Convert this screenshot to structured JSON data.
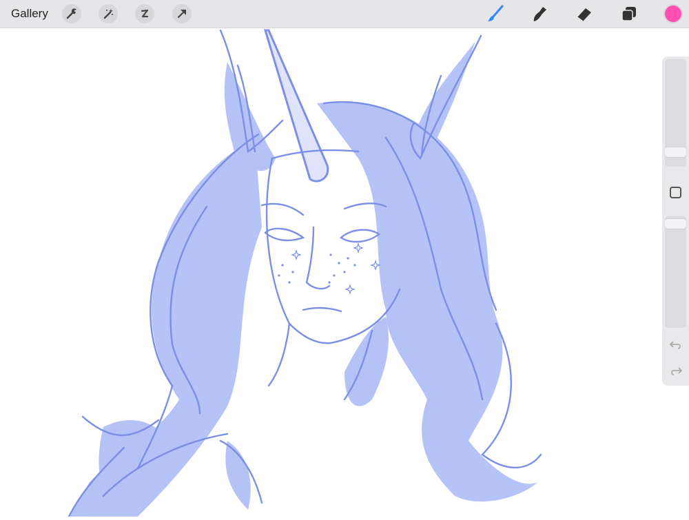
{
  "toolbar": {
    "gallery_label": "Gallery",
    "left_tools": [
      {
        "icon": "wrench-icon"
      },
      {
        "icon": "magic-wand-icon"
      },
      {
        "icon": "selection-s-icon"
      },
      {
        "icon": "arrow-transform-icon"
      }
    ],
    "right_tools": [
      {
        "icon": "brush-icon",
        "active": true
      },
      {
        "icon": "smudge-icon"
      },
      {
        "icon": "eraser-icon"
      },
      {
        "icon": "layers-icon"
      }
    ],
    "current_color": "#ff4fb0",
    "active_tool_color": "#2f86ff"
  },
  "sidebar": {
    "brush_size_level": 0.1,
    "opacity_level": 0.97,
    "icons": [
      "modify-square-icon",
      "undo-icon",
      "redo-icon"
    ]
  },
  "canvas": {
    "stroke_color": "#7b8fe6",
    "fill_color": "#a9b8f4"
  }
}
